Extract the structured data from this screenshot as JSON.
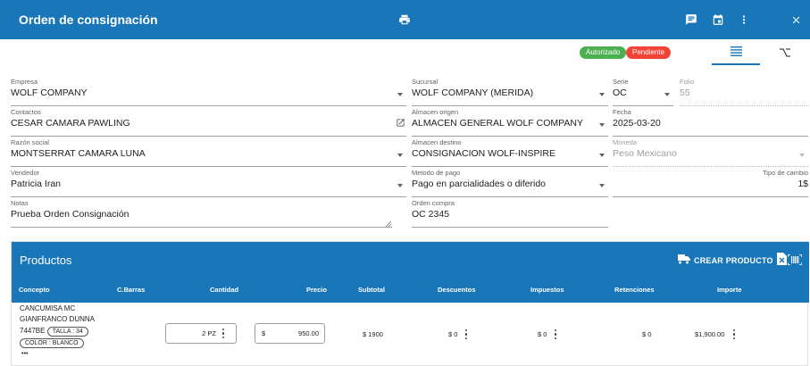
{
  "header": {
    "title": "Orden de consignación",
    "icons": [
      "printer-icon",
      "comment-icon",
      "calendar-icon",
      "more-vert-icon",
      "close-icon"
    ]
  },
  "status": {
    "authorized": "Autorizado",
    "pending": "Pendiente",
    "authorized_color": "#4caf50",
    "pending_color": "#f44336"
  },
  "form": {
    "empresa": {
      "label": "Empresa",
      "value": "WOLF COMPANY"
    },
    "sucursal": {
      "label": "Sucursal",
      "value": "WOLF COMPANY (MERIDA)"
    },
    "serie": {
      "label": "Serie",
      "value": "OC"
    },
    "folio": {
      "label": "Folio",
      "value": "55"
    },
    "contactos": {
      "label": "Contactos",
      "value": "CESAR CAMARA PAWLING"
    },
    "almacen_origen": {
      "label": "Almacen origen",
      "value": "ALMACEN GENERAL WOLF COMPANY"
    },
    "fecha": {
      "label": "Fecha",
      "value": "2025-03-20"
    },
    "razon_social": {
      "label": "Razón social",
      "value": "MONTSERRAT CAMARA LUNA"
    },
    "almacen_destino": {
      "label": "Almacen destino",
      "value": "CONSIGNACION WOLF-INSPIRE"
    },
    "moneda": {
      "label": "Moneda",
      "value": "Peso Mexicano"
    },
    "vendedor": {
      "label": "Vendedor",
      "value": "Patricia Iran"
    },
    "metodo_pago": {
      "label": "Metodo de pago",
      "value": "Pago en parcialidades o diferido"
    },
    "tipo_cambio": {
      "label": "Tipo de cambio",
      "value": "1$"
    },
    "notas": {
      "label": "Notas",
      "value": "Prueba Orden Consignación"
    },
    "orden_compra": {
      "label": "Orden compra",
      "value": "OC 2345"
    }
  },
  "products": {
    "title": "Productos",
    "create_label": "CREAR PRODUCTO",
    "columns": [
      "Concepto",
      "C.Barras",
      "Cantidad",
      "Precio",
      "Subtotal",
      "Descuentos",
      "Impuestos",
      "Retenciones",
      "Importe"
    ],
    "rows": [
      {
        "concept_line1": "CANCUMISA MC",
        "concept_line2": "GIANFRANCO DUNNA",
        "code": "7447BE",
        "chip_size": "TALLA : 34",
        "chip_color": "COLOR : BLANCO",
        "more": "•••",
        "quantity": "2 PZ",
        "price_prefix": "$",
        "price": "950.00",
        "subtotal": "$ 1900",
        "discounts": "$ 0",
        "taxes": "$ 0",
        "retentions": "$ 0",
        "amount": "$1,900.00"
      }
    ]
  }
}
